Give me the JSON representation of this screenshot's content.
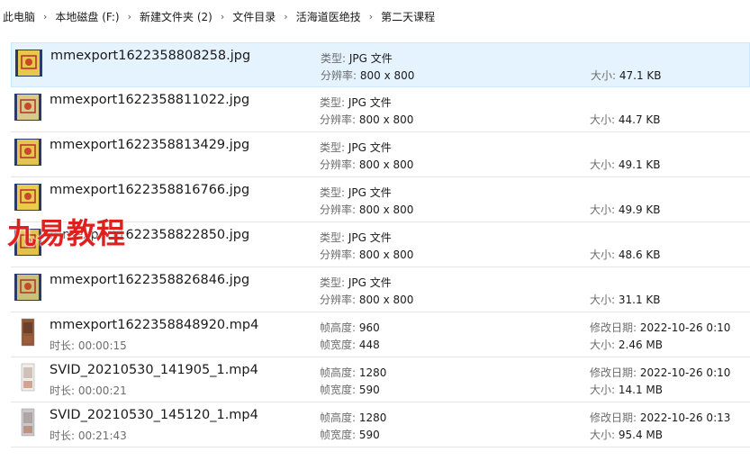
{
  "breadcrumb": [
    "此电脑",
    "本地磁盘 (F:)",
    "新建文件夹 (2)",
    "文件目录",
    "活海道医绝技",
    "第二天课程"
  ],
  "files": [
    {
      "name": "mmexport1622358808258.jpg",
      "kind": "image",
      "thumb_color": "#e8c84a",
      "sub": "",
      "c2a_label": "类型:",
      "c2a_value": "JPG 文件",
      "c2b_label": "分辨率:",
      "c2b_value": "800 x 800",
      "c3a_label": "",
      "c3a_value": "",
      "c3b_label": "大小:",
      "c3b_value": "47.1 KB"
    },
    {
      "name": "mmexport1622358811022.jpg",
      "kind": "image",
      "thumb_color": "#d8c98a",
      "sub": "",
      "c2a_label": "类型:",
      "c2a_value": "JPG 文件",
      "c2b_label": "分辨率:",
      "c2b_value": "800 x 800",
      "c3a_label": "",
      "c3a_value": "",
      "c3b_label": "大小:",
      "c3b_value": "44.7 KB"
    },
    {
      "name": "mmexport1622358813429.jpg",
      "kind": "image",
      "thumb_color": "#e6c452",
      "sub": "",
      "c2a_label": "类型:",
      "c2a_value": "JPG 文件",
      "c2b_label": "分辨率:",
      "c2b_value": "800 x 800",
      "c3a_label": "",
      "c3a_value": "",
      "c3b_label": "大小:",
      "c3b_value": "49.1 KB"
    },
    {
      "name": "mmexport1622358816766.jpg",
      "kind": "image",
      "thumb_color": "#e9cc4e",
      "sub": "",
      "c2a_label": "类型:",
      "c2a_value": "JPG 文件",
      "c2b_label": "分辨率:",
      "c2b_value": "800 x 800",
      "c3a_label": "",
      "c3a_value": "",
      "c3b_label": "大小:",
      "c3b_value": "49.9 KB"
    },
    {
      "name": "mmexport1622358822850.jpg",
      "kind": "image",
      "thumb_color": "#e3c24c",
      "sub": "",
      "c2a_label": "类型:",
      "c2a_value": "JPG 文件",
      "c2b_label": "分辨率:",
      "c2b_value": "800 x 800",
      "c3a_label": "",
      "c3a_value": "",
      "c3b_label": "大小:",
      "c3b_value": "48.6 KB"
    },
    {
      "name": "mmexport1622358826846.jpg",
      "kind": "image",
      "thumb_color": "#c9c07a",
      "sub": "",
      "c2a_label": "类型:",
      "c2a_value": "JPG 文件",
      "c2b_label": "分辨率:",
      "c2b_value": "800 x 800",
      "c3a_label": "",
      "c3a_value": "",
      "c3b_label": "大小:",
      "c3b_value": "31.1 KB"
    },
    {
      "name": "mmexport1622358848920.mp4",
      "kind": "video",
      "thumb_color": "#8a5a3a",
      "sub": "时长: 00:00:15",
      "c2a_label": "帧高度:",
      "c2a_value": "960",
      "c2b_label": "帧宽度:",
      "c2b_value": "448",
      "c3a_label": "修改日期:",
      "c3a_value": "2022-10-26 0:10",
      "c3b_label": "大小:",
      "c3b_value": "2.46 MB"
    },
    {
      "name": "SVID_20210530_141905_1.mp4",
      "kind": "video",
      "thumb_color": "#f0ece8",
      "sub": "时长: 00:00:21",
      "c2a_label": "帧高度:",
      "c2a_value": "1280",
      "c2b_label": "帧宽度:",
      "c2b_value": "590",
      "c3a_label": "修改日期:",
      "c3a_value": "2022-10-26 0:10",
      "c3b_label": "大小:",
      "c3b_value": "14.1 MB"
    },
    {
      "name": "SVID_20210530_145120_1.mp4",
      "kind": "video",
      "thumb_color": "#c8c8cc",
      "sub": "时长: 00:21:43",
      "c2a_label": "帧高度:",
      "c2a_value": "1280",
      "c2b_label": "帧宽度:",
      "c2b_value": "590",
      "c3a_label": "修改日期:",
      "c3a_value": "2022-10-26 0:13",
      "c3b_label": "大小:",
      "c3b_value": "95.4 MB"
    }
  ],
  "watermark": "九易教程"
}
